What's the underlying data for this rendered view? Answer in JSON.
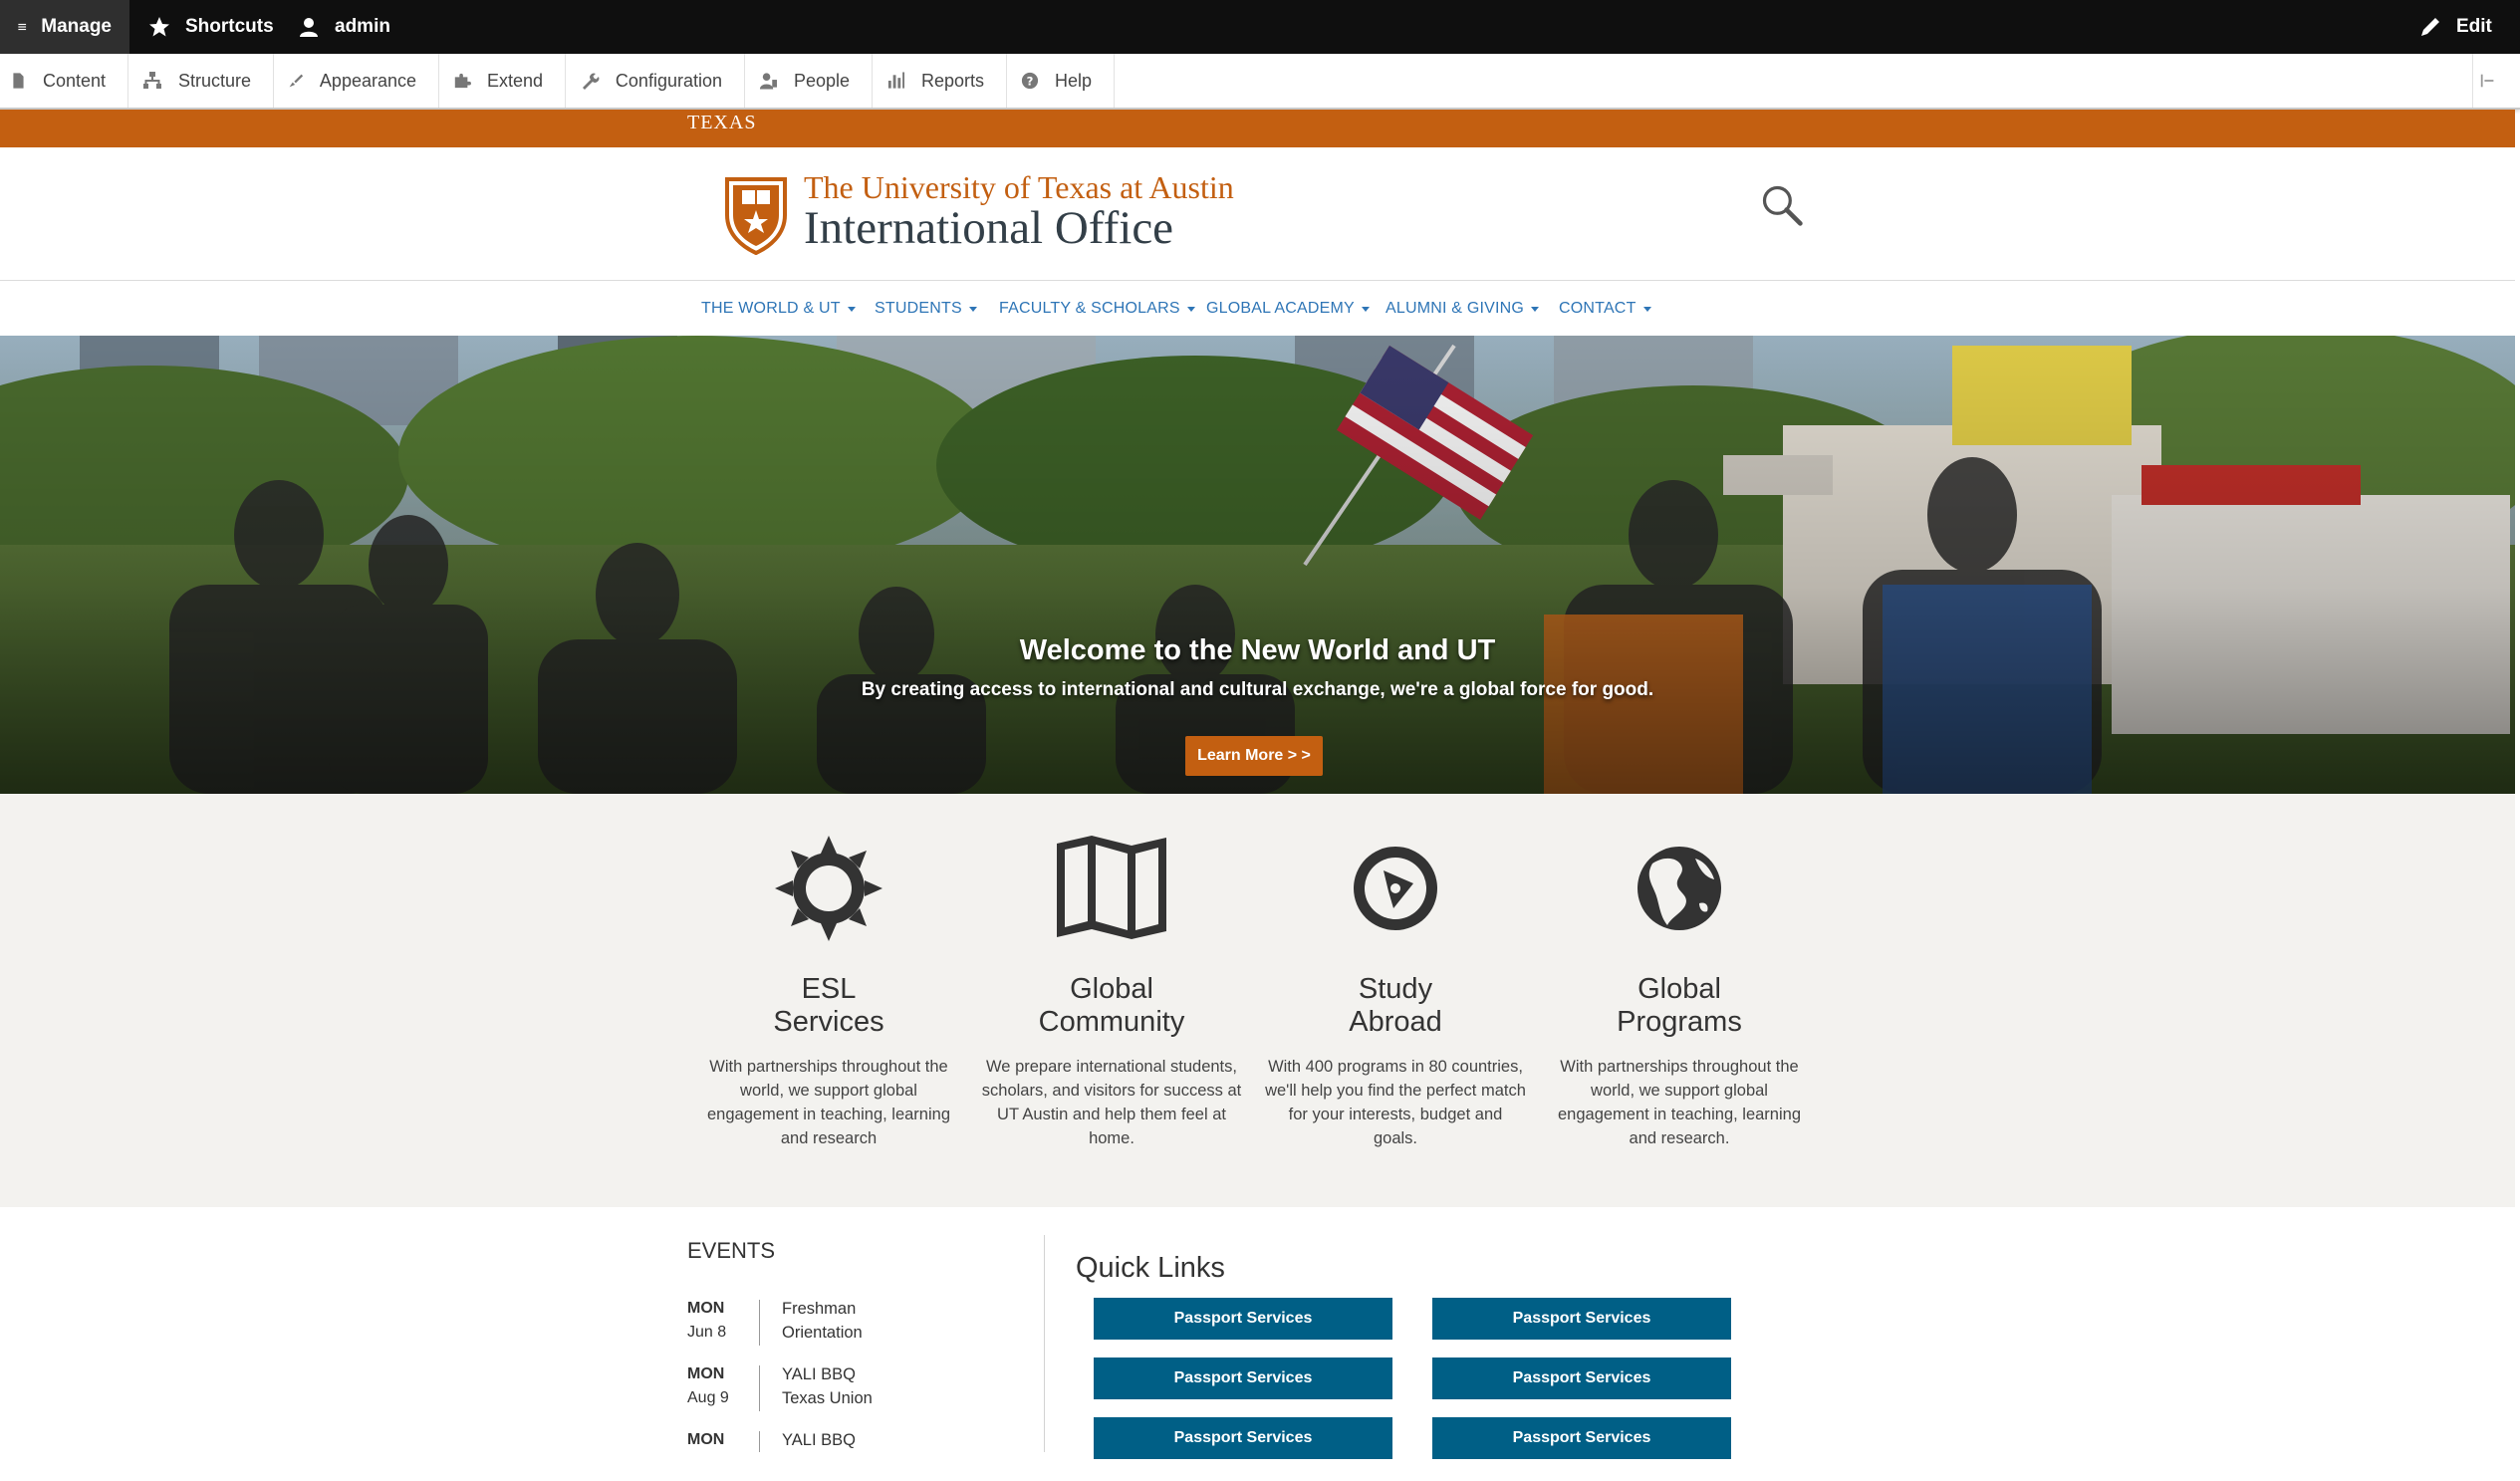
{
  "toolbar": {
    "manage": "Manage",
    "shortcuts": "Shortcuts",
    "user": "admin",
    "edit": "Edit"
  },
  "admin_menu": [
    {
      "label": "Content",
      "icon": "document-icon"
    },
    {
      "label": "Structure",
      "icon": "sitemap-icon"
    },
    {
      "label": "Appearance",
      "icon": "paintbrush-icon"
    },
    {
      "label": "Extend",
      "icon": "puzzle-icon"
    },
    {
      "label": "Configuration",
      "icon": "wrench-icon"
    },
    {
      "label": "People",
      "icon": "people-icon"
    },
    {
      "label": "Reports",
      "icon": "bar-chart-icon"
    },
    {
      "label": "Help",
      "icon": "help-icon"
    }
  ],
  "brand": {
    "texas_wordmark": "TEXAS",
    "university": "The University of Texas at Austin",
    "office": "International Office",
    "accent_color": "#c35f11",
    "link_color": "#2e75b6",
    "button_blue": "#005f86"
  },
  "nav": [
    {
      "label": "THE WORLD & UT"
    },
    {
      "label": "STUDENTS"
    },
    {
      "label": "FACULTY & SCHOLARS"
    },
    {
      "label": "GLOBAL ACADEMY"
    },
    {
      "label": "ALUMNI & GIVING"
    },
    {
      "label": "CONTACT"
    }
  ],
  "hero": {
    "title": "Welcome to the New World and UT",
    "subtitle": "By creating access to international and cultural exchange, we're a global force for good.",
    "button": "Learn More > >"
  },
  "features": [
    {
      "title_1": "ESL",
      "title_2": "Services",
      "icon": "sun-gear-icon",
      "description": "With partnerships throughout the world, we support global engagement in teaching, learning and research"
    },
    {
      "title_1": "Global",
      "title_2": "Community",
      "icon": "map-icon",
      "description": "We prepare international students, scholars, and visitors for success at UT Austin and help them feel at home."
    },
    {
      "title_1": "Study",
      "title_2": "Abroad",
      "icon": "compass-icon",
      "description": "With 400 programs in 80 countries, we'll help you find the perfect match for your interests, budget and goals."
    },
    {
      "title_1": "Global",
      "title_2": "Programs",
      "icon": "globe-icon",
      "description": "With partnerships throughout the world, we support global engagement in teaching, learning and research."
    }
  ],
  "events": {
    "heading": "EVENTS",
    "items": [
      {
        "day": "MON",
        "date": "Jun 8",
        "name_1": "Freshman",
        "name_2": "Orientation"
      },
      {
        "day": "MON",
        "date": "Aug 9",
        "name_1": "YALI BBQ",
        "name_2": "Texas Union"
      },
      {
        "day": "MON",
        "date": "",
        "name_1": "YALI BBQ",
        "name_2": ""
      }
    ]
  },
  "quick_links": {
    "heading": "Quick Links",
    "items": [
      "Passport Services",
      "Passport Services",
      "Passport Services",
      "Passport Services",
      "Passport Services",
      "Passport Services"
    ]
  }
}
